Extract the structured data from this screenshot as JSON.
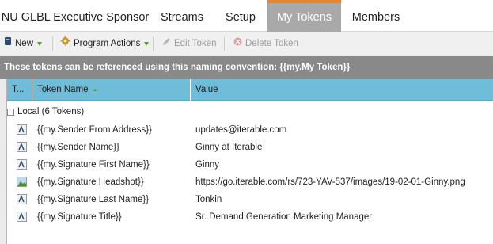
{
  "tabs": [
    {
      "label": "NU GLBL Executive Sponsor",
      "active": false
    },
    {
      "label": "Streams",
      "active": false
    },
    {
      "label": "Setup",
      "active": false
    },
    {
      "label": "My Tokens",
      "active": true
    },
    {
      "label": "Members",
      "active": false
    }
  ],
  "accent_color": "#e7842f",
  "toolbar": {
    "new_label": "New",
    "program_actions_label": "Program Actions",
    "edit_token_label": "Edit Token",
    "delete_token_label": "Delete Token"
  },
  "info_text": "These tokens can be referenced using this naming convention: {{my.My Token}}",
  "grid": {
    "columns": {
      "type": "T...",
      "token_name": "Token Name",
      "value": "Value"
    },
    "group_label": "Local (6 Tokens)",
    "rows": [
      {
        "icon": "text-token-icon",
        "name": "{{my.Sender From Address}}",
        "value": "updates@iterable.com"
      },
      {
        "icon": "text-token-icon",
        "name": "{{my.Sender Name}}",
        "value": "Ginny at Iterable"
      },
      {
        "icon": "text-token-icon",
        "name": "{{my.Signature First Name}}",
        "value": "Ginny"
      },
      {
        "icon": "image-token-icon",
        "name": "{{my.Signature Headshot}}",
        "value": "https://go.iterable.com/rs/723-YAV-537/images/19-02-01-Ginny.png"
      },
      {
        "icon": "text-token-icon",
        "name": "{{my.Signature Last Name}}",
        "value": "Tonkin"
      },
      {
        "icon": "text-token-icon",
        "name": "{{my.Signature Title}}",
        "value": "Sr. Demand Generation Marketing Manager"
      }
    ]
  }
}
